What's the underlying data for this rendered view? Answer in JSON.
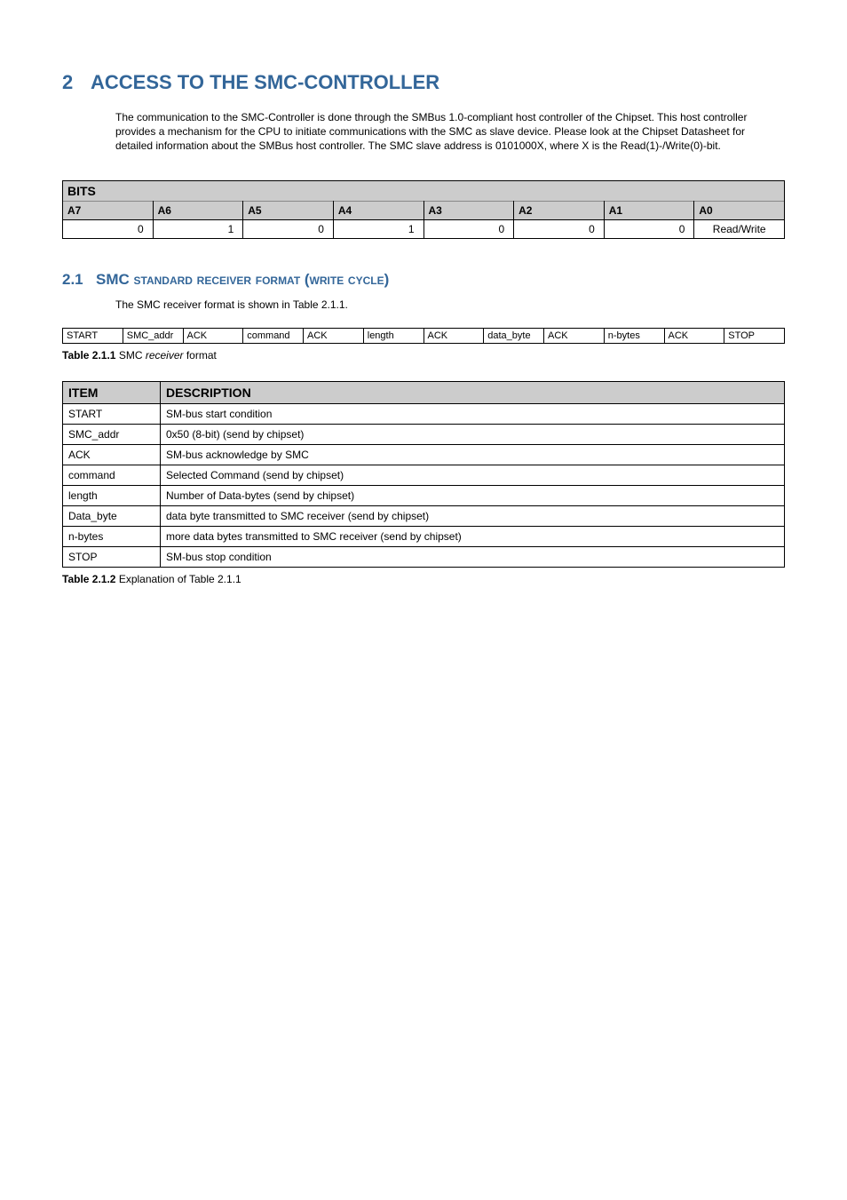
{
  "section": {
    "number": "2",
    "title": "ACCESS TO THE SMC-CONTROLLER",
    "body": "The communication to the SMC-Controller is done through the SMBus 1.0-compliant host controller of the Chipset. This host controller provides a mechanism for the CPU to initiate communications with the SMC as slave device. Please look at the Chipset Datasheet for detailed information about the SMBus host controller. The SMC slave address is 0101000X, where X is the Read(1)-/Write(0)-bit."
  },
  "bits_table": {
    "title": "BITS",
    "headers": [
      "A7",
      "A6",
      "A5",
      "A4",
      "A3",
      "A2",
      "A1",
      "A0"
    ],
    "values": [
      "0",
      "1",
      "0",
      "1",
      "0",
      "0",
      "0",
      "Read/Write"
    ]
  },
  "subsection": {
    "number": "2.1",
    "title_lead": "SMC ",
    "title_sc": "standard receiver format (write cycle)",
    "body": "The SMC receiver format is shown in Table 2.1.1."
  },
  "seq_table": {
    "cells": [
      "START",
      "SMC_addr",
      "ACK",
      "command",
      "ACK",
      "length",
      "ACK",
      "data_byte",
      "ACK",
      "n-bytes",
      "ACK",
      "STOP"
    ]
  },
  "caption211": {
    "label": "Table 2.1.1",
    "rest_prefix": " SMC ",
    "rest_italic": "receiver",
    "rest_suffix": " format"
  },
  "desc_table": {
    "headers": [
      "ITEM",
      "DESCRIPTION"
    ],
    "rows": [
      {
        "item": "START",
        "desc": "SM-bus start condition"
      },
      {
        "item": "SMC_addr",
        "desc": "0x50 (8-bit) (send by chipset)"
      },
      {
        "item": "ACK",
        "desc": "SM-bus acknowledge by SMC"
      },
      {
        "item": "command",
        "desc": "Selected Command (send by chipset)"
      },
      {
        "item": "length",
        "desc": "Number of Data-bytes (send by chipset)"
      },
      {
        "item": "Data_byte",
        "desc": "data byte transmitted to SMC receiver (send by chipset)"
      },
      {
        "item": "n-bytes",
        "desc": "more data bytes transmitted to SMC receiver (send by chipset)"
      },
      {
        "item": "STOP",
        "desc": "SM-bus stop condition"
      }
    ]
  },
  "caption212": {
    "label": "Table 2.1.2",
    "rest": " Explanation of Table 2.1.1"
  }
}
